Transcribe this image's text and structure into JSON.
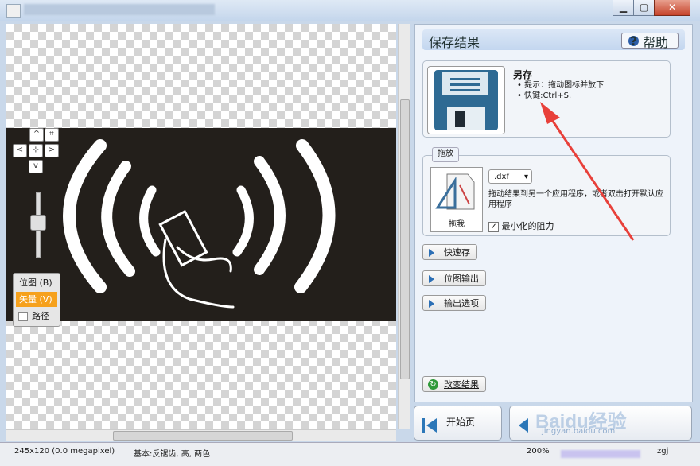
{
  "window": {
    "minimize_icon": "minimize-icon",
    "maximize_icon": "maximize-icon",
    "close_icon": "close-icon"
  },
  "nav": {
    "up": "^",
    "left": "<",
    "center": "⊹",
    "right": ">",
    "down": "v",
    "fit": "⌗"
  },
  "modes": [
    {
      "label": "位图 (B)"
    },
    {
      "label": "矢量 (V)"
    },
    {
      "label": "路径"
    }
  ],
  "panel": {
    "title": "保存结果",
    "help_label": "帮助",
    "save_as": {
      "title": "另存",
      "hints": [
        "提示：拖动图标并放下",
        "快键:Ctrl+S."
      ]
    },
    "drag": {
      "group_label": "拖放",
      "icon_label": "拖我",
      "format": ".dxf",
      "description": "拖动结果到另一个应用程序，或者双击打开默认应用程序",
      "minimize_label": "最小化的阻力",
      "minimize_checked": true
    },
    "actions": [
      "快速存",
      "位图输出",
      "输出选项"
    ],
    "change_label": "改变结果"
  },
  "buttons": {
    "start": "开始页"
  },
  "status": {
    "size": "245x120 (0.0 megapixel)",
    "basics": "基本:反锯齿, 高, 两色",
    "zoom": "200%",
    "user": "zgj"
  },
  "watermark": {
    "brand": "Baidu经验",
    "url": "jingyan.baidu.com"
  },
  "colors": {
    "accent": "#f6a11c",
    "arrow": "#e8403a",
    "dark_band": "#231f1b"
  }
}
